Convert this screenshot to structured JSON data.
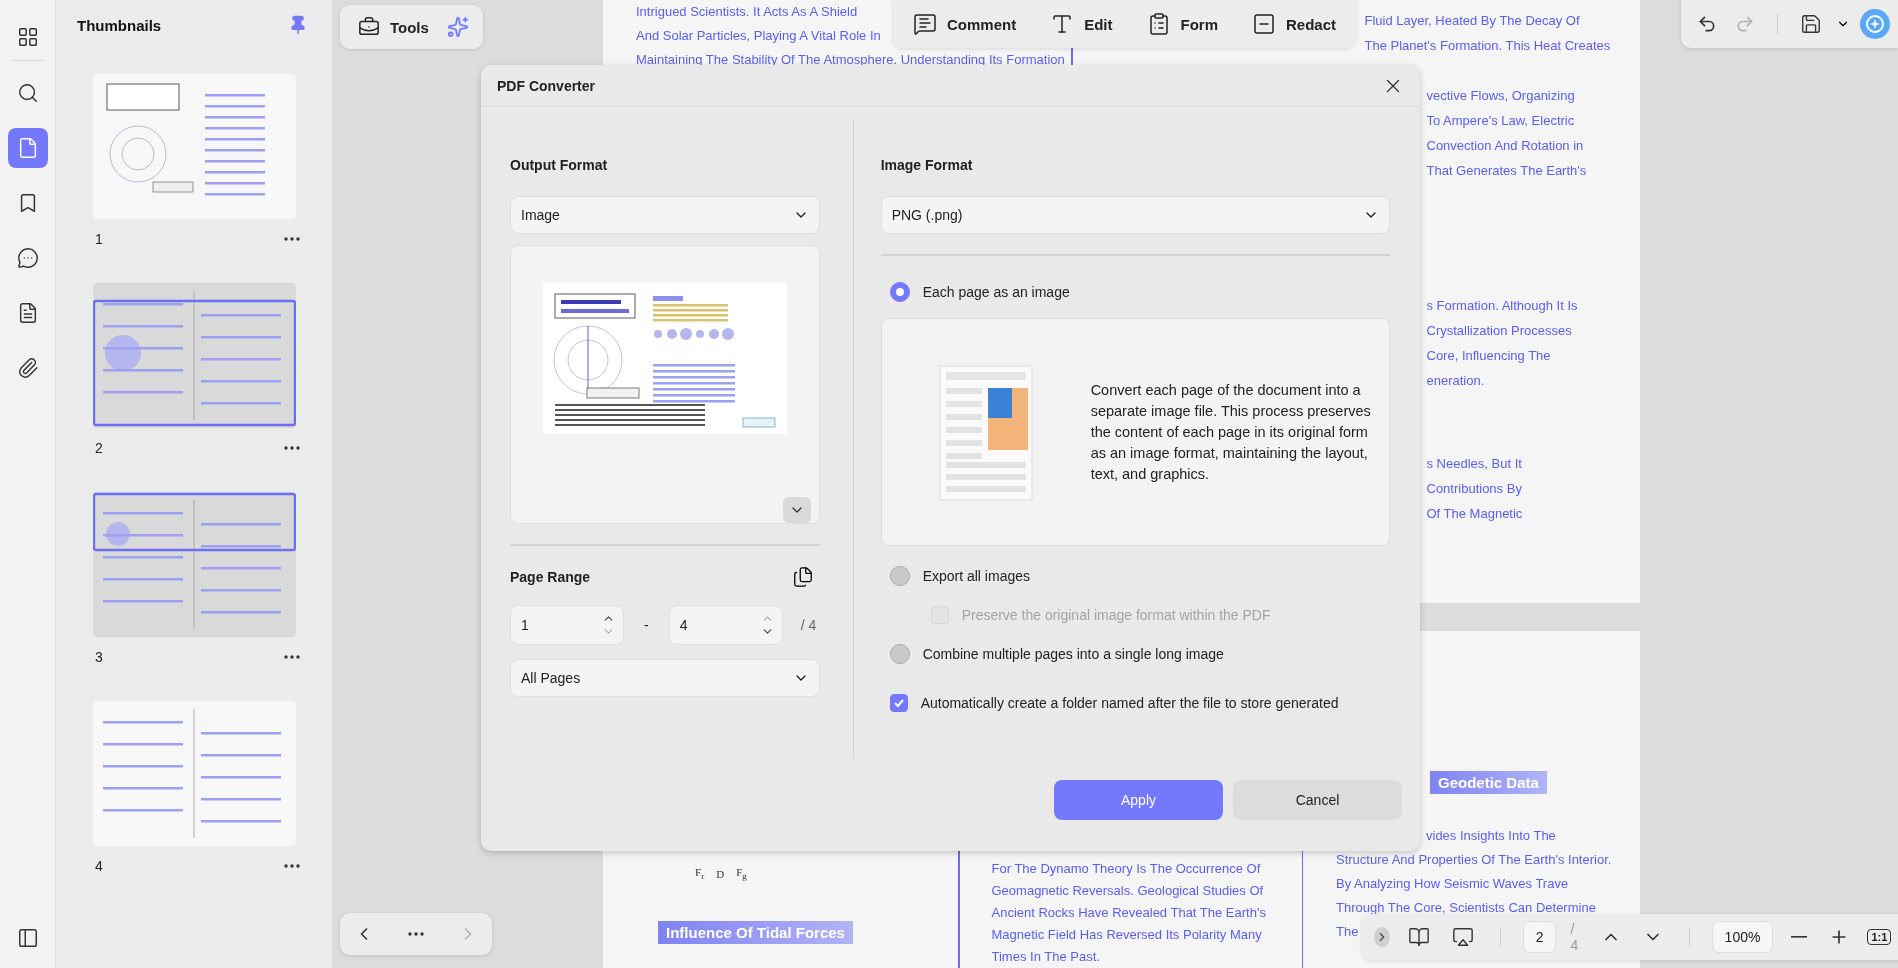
{
  "rail": {
    "items": [
      {
        "kind": "grid",
        "selected": false
      },
      {
        "kind": "search",
        "selected": false
      },
      {
        "kind": "page",
        "selected": true
      },
      {
        "kind": "bookmark",
        "selected": false
      },
      {
        "kind": "comment",
        "selected": false
      },
      {
        "kind": "form",
        "selected": false
      },
      {
        "kind": "attachment",
        "selected": false
      }
    ]
  },
  "thumbnails": {
    "title": "Thumbnails",
    "pinned": true,
    "pages": [
      {
        "label": "1",
        "in_view": false
      },
      {
        "label": "2",
        "in_view": true
      },
      {
        "label": "3",
        "in_view": true
      },
      {
        "label": "4",
        "in_view": false
      }
    ]
  },
  "toolbar": {
    "tools_label": "Tools",
    "items": [
      {
        "kind": "comment",
        "label": "Comment"
      },
      {
        "kind": "edit",
        "label": "Edit"
      },
      {
        "kind": "form",
        "label": "Form"
      },
      {
        "kind": "redact",
        "label": "Redact"
      }
    ],
    "redo_disabled": true
  },
  "document": {
    "page1": {
      "left_lines": [
        "Intrigued Scientists. It Acts As A Shield",
        "And Solar Particles, Playing A Vital Role In",
        "Maintaining The Stability Of The Atmosphere. Understanding Its Formation"
      ],
      "right_blocks": [
        [
          "Fluid Layer, Heated By The Decay Of",
          "The Planet's Formation. This Heat Creates"
        ],
        [
          "vective Flows, Organizing",
          "To Ampere's Law, Electric",
          "Convection And Rotation in",
          "That Generates The Earth's"
        ],
        [
          "s Formation. Although It Is",
          "Crystallization Processes",
          "Core, Influencing The",
          "eneration."
        ],
        [
          "s Needles, But It",
          "Contributions By",
          "Of The Magnetic"
        ]
      ]
    },
    "page2": {
      "diagram_labels": [
        "F$_{r}$",
        "D",
        "F$_{g}$"
      ],
      "left_heading": "Influence Of Tidal Forces",
      "middle_lines": [
        "For The Dynamo Theory Is The Occurrence Of",
        "Geomagnetic Reversals. Geological Studies Of",
        "Ancient Rocks Have Revealed That The Earth's",
        "Magnetic Field Has Reversed Its Polarity Many",
        "Times In The Past."
      ],
      "right_heading": "Geodetic Data",
      "right_lines": [
        "vides Insights Into The",
        "Structure And Properties Of The Earth's Interior.",
        "By Analyzing How Seismic Waves Trave",
        "Through The Core, Scientists Can Determine",
        "The"
      ]
    }
  },
  "dialog": {
    "title": "PDF Converter",
    "output_format": {
      "label": "Output Format",
      "value": "Image"
    },
    "page_range": {
      "label": "Page Range",
      "from": {
        "value": "1",
        "down_disabled": true
      },
      "separator": "-",
      "to": {
        "value": "4",
        "up_disabled": true
      },
      "total": "/ 4",
      "preset": "All Pages"
    },
    "image_format": {
      "label": "Image Format",
      "value": "PNG (.png)"
    },
    "options": [
      {
        "kind": "radio",
        "label": "Each page as an image",
        "selected": true,
        "description": "Convert each page of the document into a separate image file. This process preserves the content of each page in its original form as an image format, maintaining the layout, text, and graphics."
      },
      {
        "kind": "radio",
        "label": "Export all images",
        "selected": false,
        "children": [
          {
            "kind": "checkbox",
            "label": "Preserve the original image format within the PDF",
            "checked": false,
            "disabled": true
          }
        ]
      },
      {
        "kind": "radio",
        "label": "Combine multiple pages into a single long image",
        "selected": false
      },
      {
        "kind": "checkbox",
        "label": "Automatically create a folder named after the file to store generated",
        "checked": true
      }
    ],
    "buttons": [
      {
        "kind": "primary",
        "label": "Apply"
      },
      {
        "kind": "secondary",
        "label": "Cancel"
      }
    ]
  },
  "nav": {
    "prev_disabled": false,
    "next_disabled": true
  },
  "zoom_bar": {
    "page": "2",
    "total": "/ 4",
    "zoom": "100%",
    "actual_size": "1:1"
  }
}
